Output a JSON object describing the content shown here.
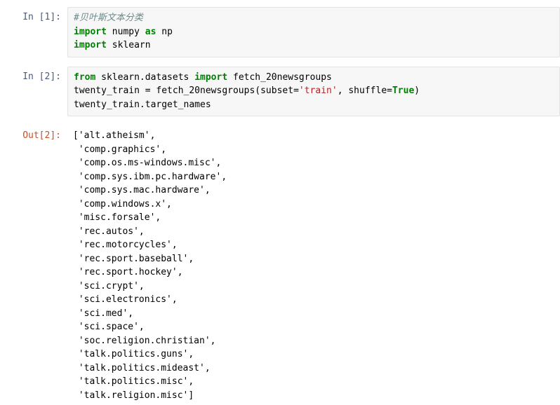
{
  "notebook": {
    "cells": [
      {
        "type": "code",
        "prompt": "In [1]:",
        "lines": [
          [
            {
              "t": "comment",
              "s": "#贝叶斯文本分类"
            }
          ],
          [
            {
              "t": "keyword",
              "s": "import"
            },
            {
              "t": "plain",
              "s": " numpy "
            },
            {
              "t": "keyword",
              "s": "as"
            },
            {
              "t": "plain",
              "s": " np"
            }
          ],
          [
            {
              "t": "keyword",
              "s": "import"
            },
            {
              "t": "plain",
              "s": " sklearn"
            }
          ]
        ]
      },
      {
        "type": "code",
        "prompt": "In [2]:",
        "lines": [
          [
            {
              "t": "keyword",
              "s": "from"
            },
            {
              "t": "plain",
              "s": " sklearn.datasets "
            },
            {
              "t": "keyword",
              "s": "import"
            },
            {
              "t": "plain",
              "s": " fetch_20newsgroups"
            }
          ],
          [
            {
              "t": "plain",
              "s": "twenty_train = fetch_20newsgroups(subset="
            },
            {
              "t": "string",
              "s": "'train'"
            },
            {
              "t": "plain",
              "s": ", shuffle="
            },
            {
              "t": "keyword",
              "s": "True"
            },
            {
              "t": "plain",
              "s": ")"
            }
          ],
          [
            {
              "t": "plain",
              "s": "twenty_train.target_names"
            }
          ]
        ]
      },
      {
        "type": "output",
        "prompt": "Out[2]:",
        "lines": [
          "['alt.atheism',",
          " 'comp.graphics',",
          " 'comp.os.ms-windows.misc',",
          " 'comp.sys.ibm.pc.hardware',",
          " 'comp.sys.mac.hardware',",
          " 'comp.windows.x',",
          " 'misc.forsale',",
          " 'rec.autos',",
          " 'rec.motorcycles',",
          " 'rec.sport.baseball',",
          " 'rec.sport.hockey',",
          " 'sci.crypt',",
          " 'sci.electronics',",
          " 'sci.med',",
          " 'sci.space',",
          " 'soc.religion.christian',",
          " 'talk.politics.guns',",
          " 'talk.politics.mideast',",
          " 'talk.politics.misc',",
          " 'talk.religion.misc']"
        ]
      }
    ]
  },
  "colors": {
    "prompt_in": "#4a5b80",
    "prompt_out": "#c4502a",
    "keyword": "#008000",
    "string": "#ba2121",
    "comment": "#6a8a8a",
    "cell_background": "#f7f7f7",
    "cell_border": "#e3e3e3",
    "page_background": "#ffffff"
  }
}
